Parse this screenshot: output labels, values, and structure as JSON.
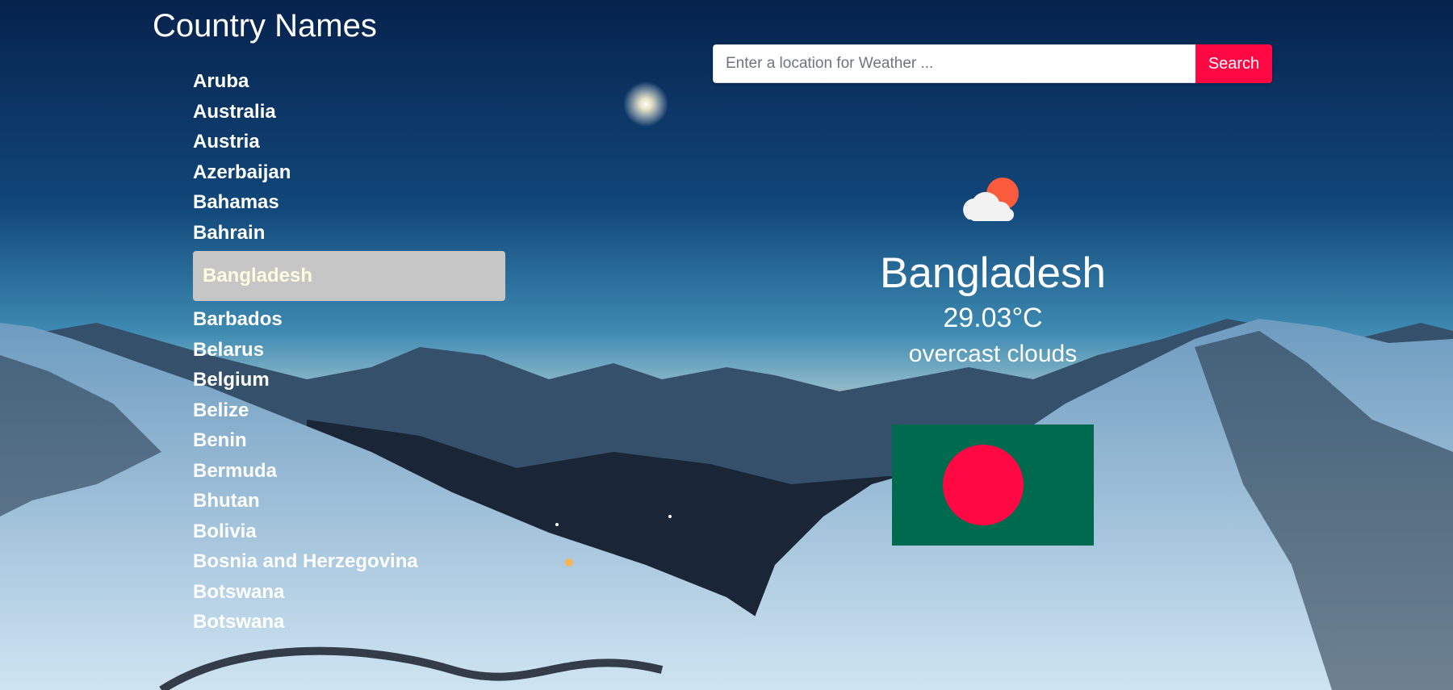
{
  "page": {
    "title": "Country Names"
  },
  "countries": [
    "Aruba",
    "Australia",
    "Austria",
    "Azerbaijan",
    "Bahamas",
    "Bahrain",
    "Bangladesh",
    "Barbados",
    "Belarus",
    "Belgium",
    "Belize",
    "Benin",
    "Bermuda",
    "Bhutan",
    "Bolivia",
    "Bosnia and Herzegovina",
    "Botswana",
    "Botswana"
  ],
  "selected_country": "Bangladesh",
  "search": {
    "placeholder": "Enter a location for Weather ...",
    "value": "",
    "button_label": "Search"
  },
  "weather": {
    "icon": "cloud-sun-icon",
    "city": "Bangladesh",
    "temperature": "29.03°C",
    "description": "overcast clouds",
    "flag_icon": "bangladesh-flag-icon"
  },
  "colors": {
    "accent": "#ff0844",
    "flag_green": "#006a4e",
    "flag_red": "#f42a41",
    "selected_bg": "#c6c6c6"
  }
}
